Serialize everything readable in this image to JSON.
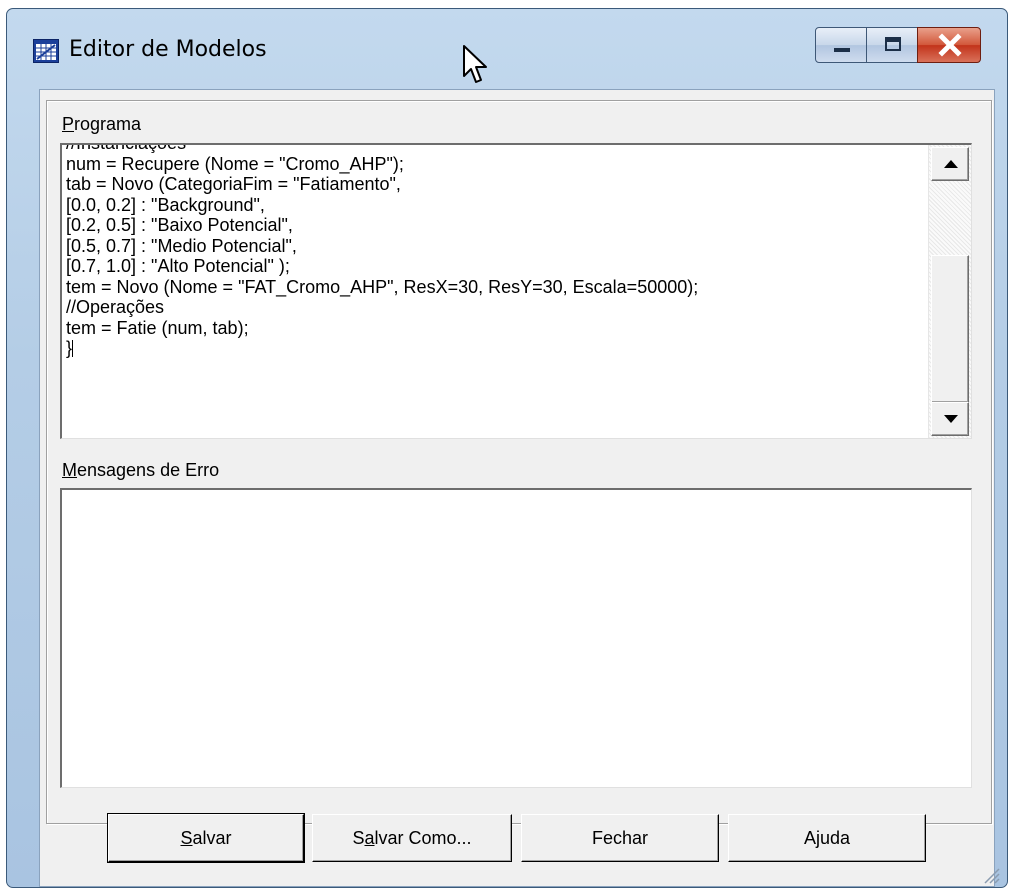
{
  "window": {
    "title": "Editor de Modelos"
  },
  "program": {
    "label_prefix": "P",
    "label_rest": "rograma",
    "lines": [
      "//Instanciações",
      "num = Recupere (Nome = \"Cromo_AHP\");",
      "tab = Novo (CategoriaFim = \"Fatiamento\",",
      "[0.0, 0.2] : \"Background\",",
      "[0.2, 0.5] : \"Baixo Potencial\",",
      "[0.5, 0.7] : \"Medio Potencial\",",
      "[0.7, 1.0] : \"Alto Potencial\" );",
      "tem = Novo (Nome = \"FAT_Cromo_AHP\", ResX=30, ResY=30, Escala=50000);",
      "//Operações",
      "tem = Fatie (num, tab);",
      "}"
    ]
  },
  "errors": {
    "label_prefix": "M",
    "label_rest": "ensagens de Erro",
    "text": ""
  },
  "buttons": {
    "salvar_prefix": "S",
    "salvar_rest": "alvar",
    "salvar_como_a": "S",
    "salvar_como_u": "a",
    "salvar_como_rest": "lvar Como...",
    "fechar": "Fechar",
    "ajuda": "Ajuda"
  },
  "icons": {
    "app": "grid-window-icon",
    "minimize": "minimize-icon",
    "maximize": "maximize-icon",
    "close": "close-icon",
    "cursor": "mouse-cursor-icon"
  },
  "colors": {
    "title_bar": "#b4cde6",
    "close_button": "#c2331a",
    "dialog_bg": "#f0f0f0"
  }
}
